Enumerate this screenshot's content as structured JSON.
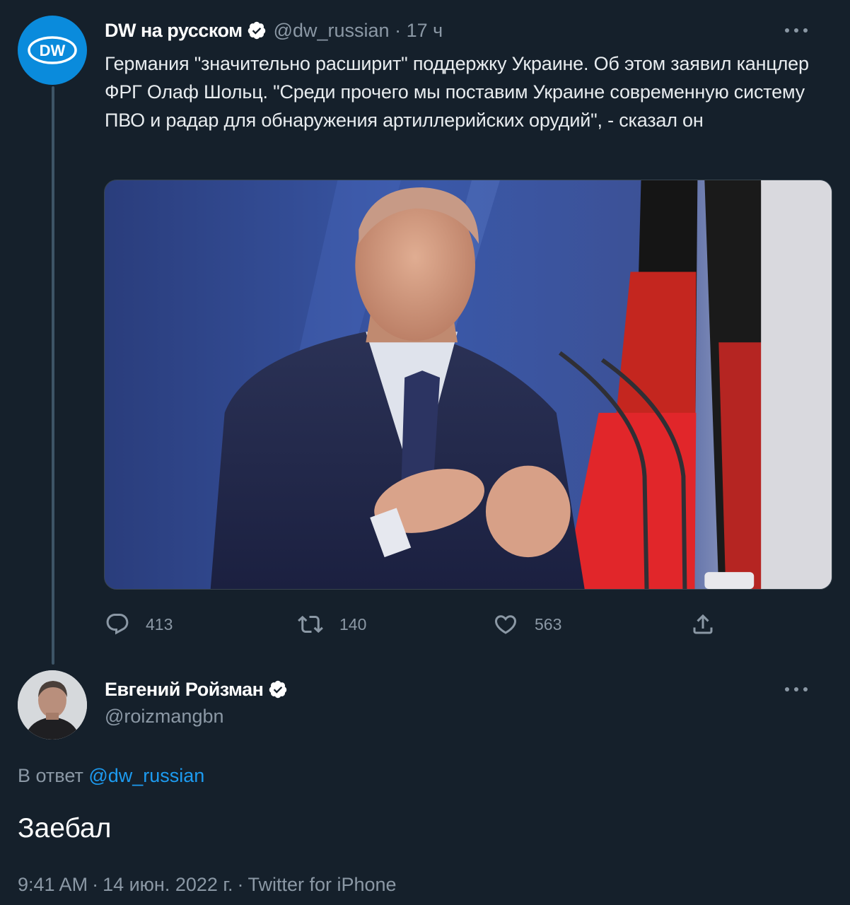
{
  "tweet1": {
    "author_name": "DW на русском",
    "handle": "@dw_russian",
    "time": "17 ч",
    "separator": "·",
    "avatar_text": "DW",
    "text": "Германия \"значительно расширит\" поддержку Украине. Об этом заявил канцлер ФРГ Олаф Шольц. \"Среди прочего мы поставим Украине современную систему ПВО и радар для обнаружения артиллерийских орудий\", - сказал он",
    "actions": {
      "replies": "413",
      "retweets": "140",
      "likes": "563"
    }
  },
  "tweet2": {
    "author_name": "Евгений Ройзман",
    "handle": "@roizmangbn",
    "reply_prefix": "В ответ",
    "reply_handle": "@dw_russian",
    "text": "Заебал",
    "time": "9:41 AM",
    "date": "14 июн. 2022 г.",
    "source": "Twitter for iPhone",
    "separator": "·"
  },
  "colors": {
    "background": "#15202b",
    "secondary_text": "#8b98a5",
    "accent": "#1d9bf0",
    "dw_blue": "#0a8bdc"
  },
  "icons": [
    "verified-badge-icon",
    "more-icon",
    "reply-icon",
    "retweet-icon",
    "like-icon",
    "share-icon"
  ]
}
